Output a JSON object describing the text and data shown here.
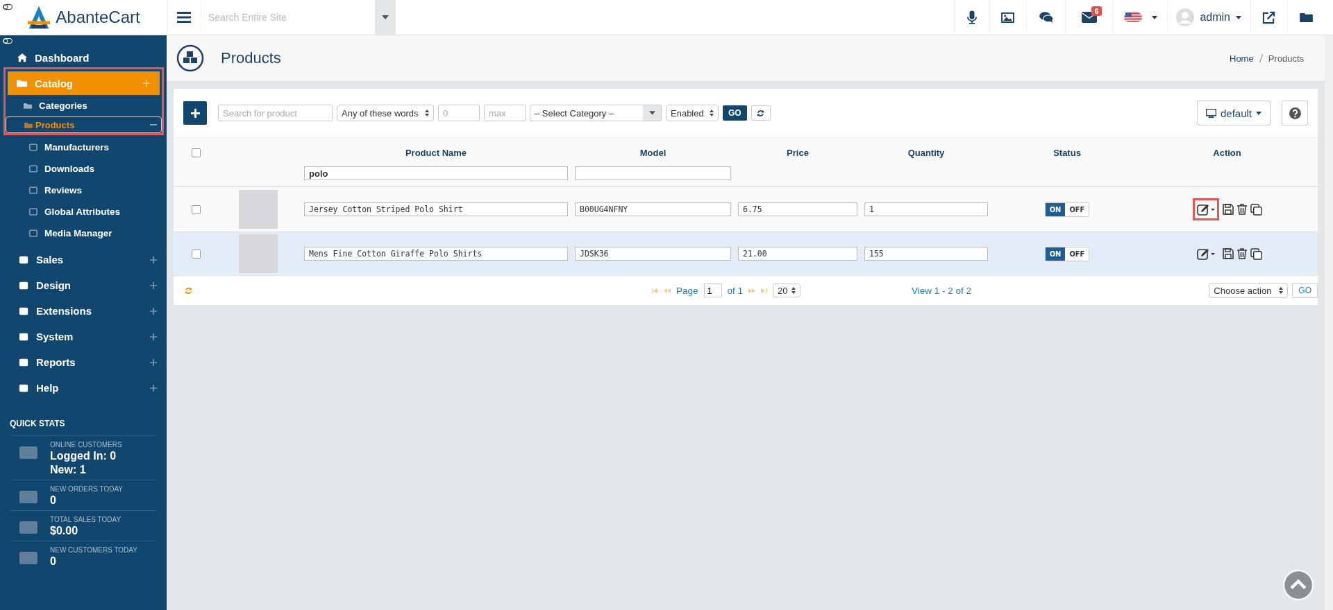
{
  "logo": {
    "text": "AbanteCart"
  },
  "header": {
    "search": {
      "placeholder": "Search Entire Site"
    },
    "mail_badge": "6",
    "user": "admin"
  },
  "sidebar": {
    "items": [
      {
        "label": "Dashboard",
        "kind": "link"
      },
      {
        "label": "Catalog",
        "kind": "group",
        "expanded": true,
        "highlighted": true,
        "children": [
          {
            "label": "Categories",
            "selected": false
          },
          {
            "label": "Products",
            "selected": true
          }
        ]
      },
      {
        "label": "Manufacturers",
        "kind": "sub"
      },
      {
        "label": "Downloads",
        "kind": "sub"
      },
      {
        "label": "Reviews",
        "kind": "sub"
      },
      {
        "label": "Global Attributes",
        "kind": "sub"
      },
      {
        "label": "Media Manager",
        "kind": "sub"
      },
      {
        "label": "Sales",
        "kind": "group",
        "expanded": false
      },
      {
        "label": "Design",
        "kind": "group",
        "expanded": false
      },
      {
        "label": "Extensions",
        "kind": "group",
        "expanded": false
      },
      {
        "label": "System",
        "kind": "group",
        "expanded": false
      },
      {
        "label": "Reports",
        "kind": "group",
        "expanded": false
      },
      {
        "label": "Help",
        "kind": "group",
        "expanded": false
      }
    ],
    "quick_stats": {
      "title": "QUICK STATS",
      "stats": [
        {
          "label": "ONLINE CUSTOMERS",
          "values": [
            "Logged In: 0",
            "New: 1"
          ]
        },
        {
          "label": "NEW ORDERS TODAY",
          "values": [
            "0"
          ]
        },
        {
          "label": "TOTAL SALES TODAY",
          "values": [
            "$0.00"
          ]
        },
        {
          "label": "NEW CUSTOMERS TODAY",
          "values": [
            "0"
          ]
        }
      ]
    }
  },
  "page": {
    "title": "Products",
    "breadcrumb": [
      "Home",
      "Products"
    ]
  },
  "toolbar": {
    "search": {
      "placeholder": "Search for product"
    },
    "match": "Any of these words",
    "min": {
      "placeholder": "0"
    },
    "max": {
      "placeholder": "max"
    },
    "category": "– Select Category –",
    "status": "Enabled",
    "go": "GO",
    "view": "default"
  },
  "table": {
    "all_selected": false,
    "columns": [
      "Product Name",
      "Model",
      "Price",
      "Quantity",
      "Status",
      "Action"
    ],
    "name_filter": "polo",
    "rows": [
      {
        "name": "Jersey Cotton Striped Polo Shirt",
        "model": "B00UG4NFNY",
        "price": "6.75",
        "quantity": "1",
        "on_label": "ON",
        "off_label": "OFF",
        "on": true,
        "selected": false,
        "hovered": false,
        "edit_highlighted": true
      },
      {
        "name": "Mens Fine Cotton Giraffe Polo Shirts",
        "model": "JDSK36",
        "price": "21.00",
        "quantity": "155",
        "on_label": "ON",
        "off_label": "OFF",
        "on": true,
        "selected": false,
        "hovered": true,
        "edit_highlighted": false
      }
    ],
    "footer": {
      "page_label": "Page",
      "page": "1",
      "of": "of 1",
      "per_page": "20",
      "view": "View 1 - 2 of 2",
      "action": "Choose action",
      "go": "GO"
    }
  }
}
